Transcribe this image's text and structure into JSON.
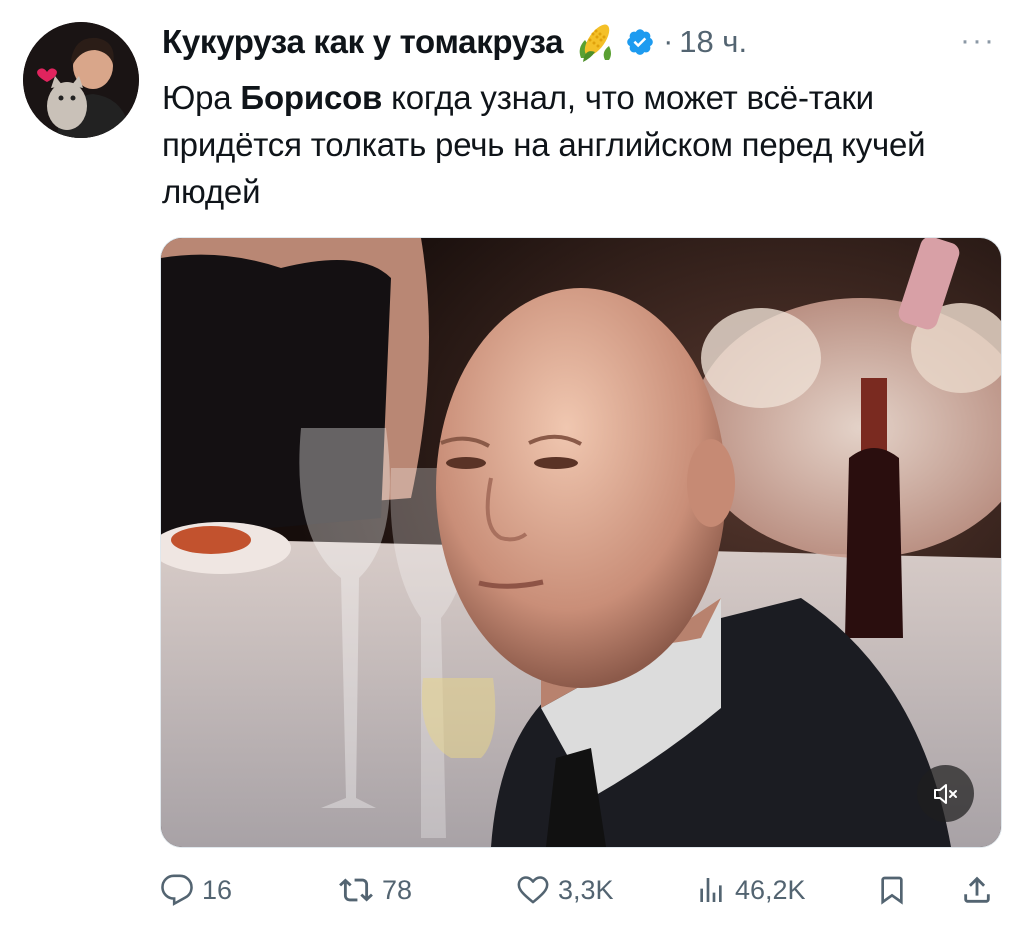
{
  "tweet": {
    "display_name": "Кукуруза как у томакруза",
    "name_emoji": "corn-emoji",
    "verified": true,
    "separator": "·",
    "time": "18 ч.",
    "more": "···",
    "text_part1": "Юра ",
    "text_bold": "Борисов",
    "text_part2": " когда узнал, что может всё-таки придётся толкать речь на английском перед кучей людей"
  },
  "media": {
    "type": "video",
    "mute_icon": "speaker-muted-icon"
  },
  "actions": {
    "replies": "16",
    "reposts": "78",
    "likes": "3,3K",
    "views": "46,2K",
    "bookmark_icon": "bookmark-icon",
    "share_icon": "share-icon"
  },
  "colors": {
    "text": "#0f1419",
    "secondary": "#536471",
    "verified": "#1d9bf0"
  }
}
